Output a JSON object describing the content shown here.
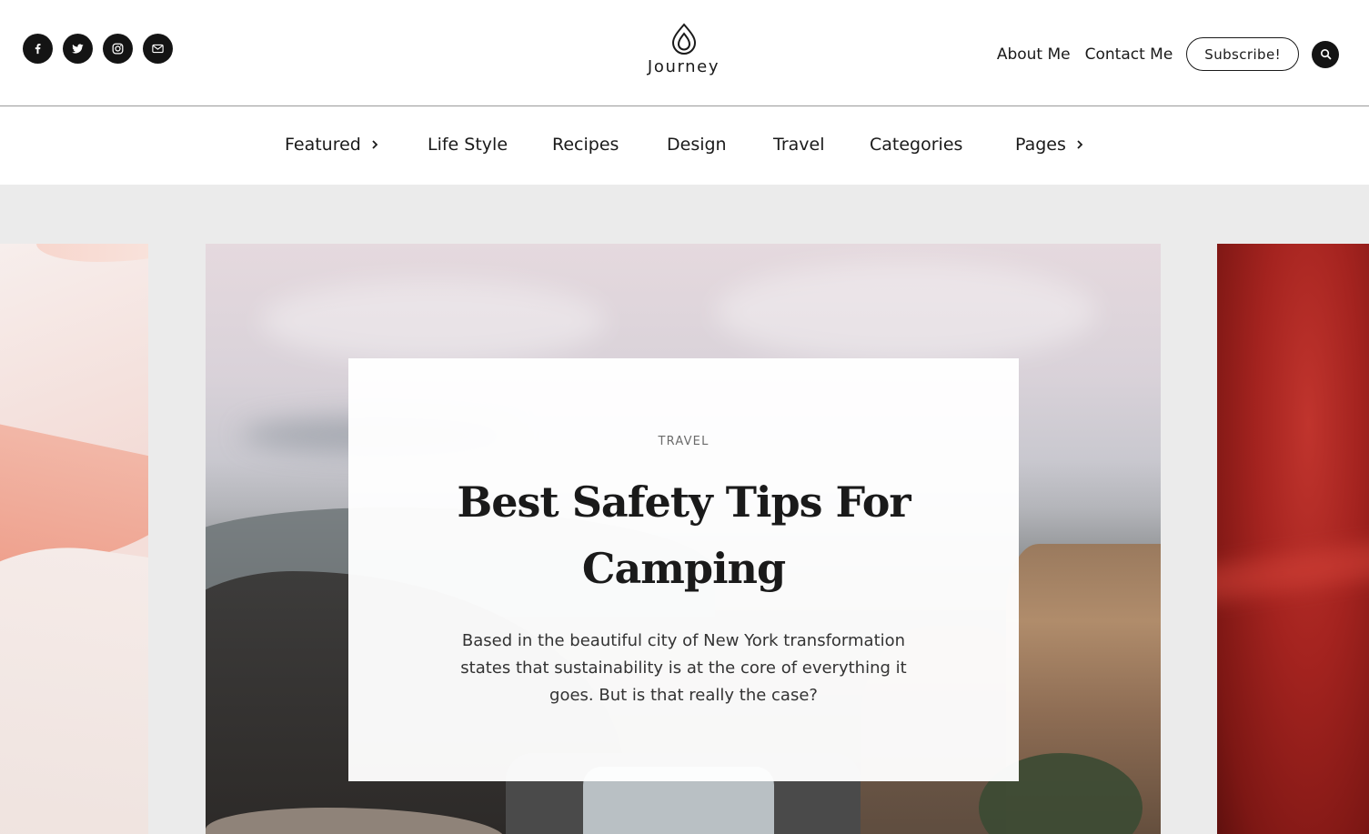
{
  "header": {
    "logo_text": "Journey",
    "socials": [
      {
        "icon": "facebook-icon"
      },
      {
        "icon": "twitter-icon"
      },
      {
        "icon": "instagram-icon"
      },
      {
        "icon": "mail-icon"
      }
    ],
    "links": {
      "about": "About Me",
      "contact": "Contact Me",
      "subscribe": "Subscribe!"
    }
  },
  "nav": {
    "items": [
      {
        "label": "Featured",
        "has_submenu": true
      },
      {
        "label": "Life Style",
        "has_submenu": false
      },
      {
        "label": "Recipes",
        "has_submenu": false
      },
      {
        "label": "Design",
        "has_submenu": false
      },
      {
        "label": "Travel",
        "has_submenu": false
      },
      {
        "label": "Categories",
        "has_submenu": false
      },
      {
        "label": "Pages",
        "has_submenu": true
      }
    ]
  },
  "hero": {
    "featured": {
      "category": "TRAVEL",
      "title": "Best Safety Tips For Camping",
      "excerpt": "Based in the beautiful city of New York transformation states that sustainability is at the core of everything it goes. But is that really the case?"
    }
  },
  "colors": {
    "dark": "#141414",
    "hero_bg": "#ebebeb"
  }
}
